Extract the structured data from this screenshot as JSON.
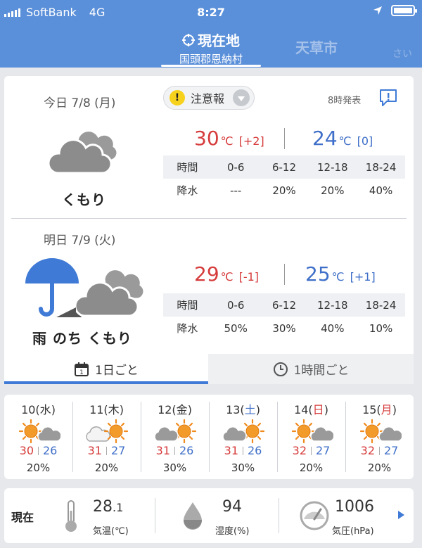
{
  "status_bar": {
    "carrier": "SoftBank",
    "network": "4G",
    "time": "8:27"
  },
  "header": {
    "current_tab": {
      "title": "現在地",
      "subtitle": "国頭郡恩納村"
    },
    "other_tab": "天草市",
    "other_tab2": "さい"
  },
  "today": {
    "date": "今日 7/8 (月)",
    "condition": "くもり",
    "alert_label": "注意報",
    "alert_mark": "!",
    "issued": "8時発表",
    "high": "30",
    "high_diff": "[+2]",
    "low": "24",
    "low_diff": "[0]",
    "unit": "℃",
    "rain_header": [
      "時間",
      "0-6",
      "6-12",
      "12-18",
      "18-24"
    ],
    "rain_values": [
      "降水",
      "---",
      "20%",
      "20%",
      "40%"
    ]
  },
  "tomorrow": {
    "date": "明日 7/9 (火)",
    "condition": "雨 のち くもり",
    "high": "29",
    "high_diff": "[-1]",
    "low": "25",
    "low_diff": "[+1]",
    "unit": "℃",
    "rain_header": [
      "時間",
      "0-6",
      "6-12",
      "12-18",
      "18-24"
    ],
    "rain_values": [
      "降水",
      "50%",
      "30%",
      "40%",
      "10%"
    ]
  },
  "view_tabs": {
    "daily": "1日ごと",
    "hourly": "1時間ごと",
    "calendar_num": "1"
  },
  "weekly": [
    {
      "day": "10",
      "dow": "水",
      "high": "30",
      "low": "26",
      "pop": "20%",
      "icon": "sun-cloud",
      "dow_type": "weekday"
    },
    {
      "day": "11",
      "dow": "木",
      "high": "31",
      "low": "27",
      "pop": "20%",
      "icon": "cloud-sun",
      "dow_type": "weekday"
    },
    {
      "day": "12",
      "dow": "金",
      "high": "31",
      "low": "26",
      "pop": "30%",
      "icon": "cloud-sun",
      "dow_type": "weekday"
    },
    {
      "day": "13",
      "dow": "土",
      "high": "31",
      "low": "26",
      "pop": "30%",
      "icon": "cloud-sun",
      "dow_type": "sat"
    },
    {
      "day": "14",
      "dow": "日",
      "high": "32",
      "low": "27",
      "pop": "20%",
      "icon": "sun-cloud",
      "dow_type": "sun"
    },
    {
      "day": "15",
      "dow": "月",
      "high": "32",
      "low": "27",
      "pop": "20%",
      "icon": "sun-cloud",
      "dow_type": "holiday"
    }
  ],
  "current": {
    "label": "現在",
    "temp_int": "28",
    "temp_dec": ".1",
    "temp_cap": "気温(℃)",
    "humidity": "94",
    "humidity_cap": "湿度(%)",
    "pressure": "1006",
    "pressure_cap": "気圧(hPa)"
  },
  "colors": {
    "header_bg": "#5a8fd9",
    "hot": "#d63b3b",
    "cold": "#3f6fc8",
    "accent": "#3f7ad6"
  }
}
